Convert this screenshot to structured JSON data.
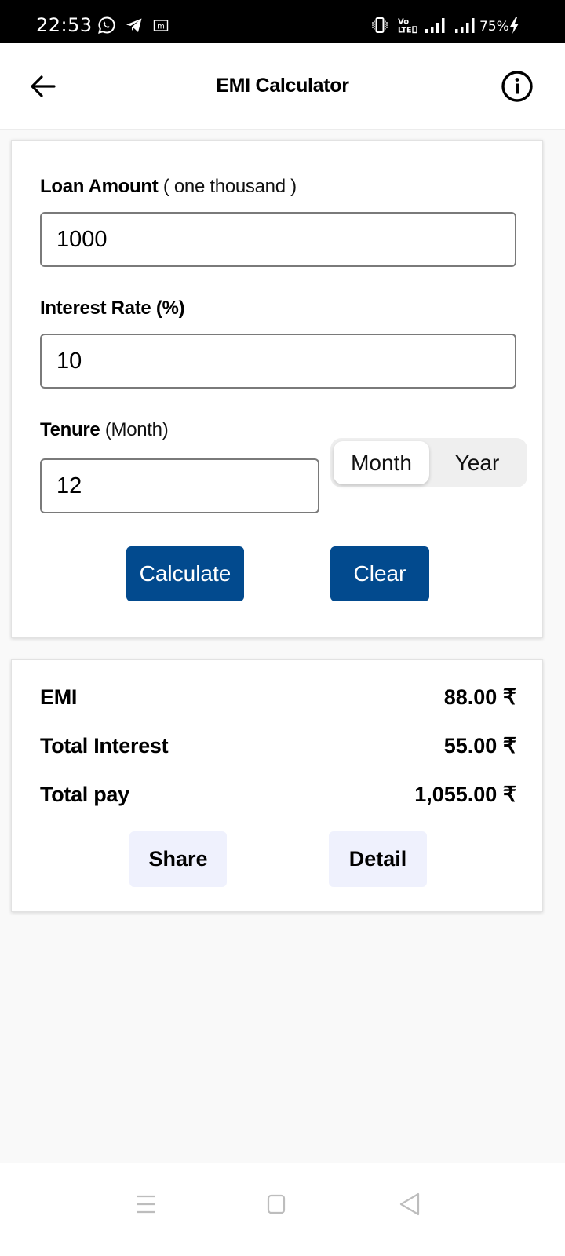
{
  "status_bar": {
    "time": "22:53",
    "notification_icons": [
      "whatsapp-icon",
      "telegram-icon",
      "m-app-icon"
    ],
    "system_icons": [
      "vibrate-icon",
      "volte-icon",
      "signal-1-icon",
      "signal-2-icon"
    ],
    "battery": "75%",
    "charging": true
  },
  "app_bar": {
    "title": "EMI Calculator",
    "back_icon": "arrow-left-icon",
    "info_icon": "info-circle-icon"
  },
  "form": {
    "loan_amount": {
      "label": "Loan Amount",
      "hint": "( one thousand  )",
      "value": "1000"
    },
    "interest_rate": {
      "label": "Interest Rate (%)",
      "value": "10"
    },
    "tenure": {
      "label": "Tenure",
      "unit_hint": "(Month)",
      "value": "12",
      "options": [
        "Month",
        "Year"
      ],
      "selected": "Month"
    },
    "buttons": {
      "calculate": "Calculate",
      "clear": "Clear"
    }
  },
  "results": {
    "rows": [
      {
        "label": "EMI",
        "value": "88.00 ₹"
      },
      {
        "label": "Total Interest",
        "value": "55.00 ₹"
      },
      {
        "label": "Total pay",
        "value": "1,055.00 ₹"
      }
    ],
    "buttons": {
      "share": "Share",
      "detail": "Detail"
    }
  },
  "nav_bar": {
    "items": [
      "recents-icon",
      "home-icon",
      "back-triangle-icon"
    ]
  },
  "colors": {
    "primary": "#024a8e",
    "soft_button": "#eff1fd",
    "background": "#f9f9f9",
    "segment_bg": "#efefef"
  }
}
